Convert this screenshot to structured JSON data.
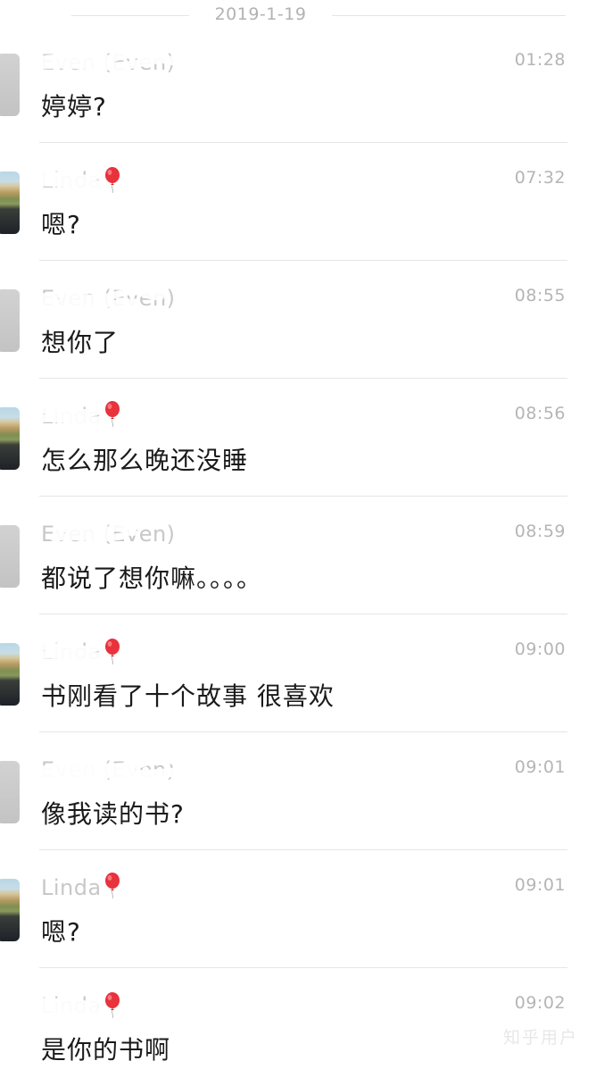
{
  "date_divider": "2019-1-19",
  "messages": [
    {
      "sender": "Even (Even)",
      "avatar": "even-avatar",
      "time": "01:28",
      "text": "婷婷?"
    },
    {
      "sender": "Linda",
      "avatar": "linda-avatar",
      "time": "07:32",
      "text": "嗯?"
    },
    {
      "sender": "Even (Even)",
      "avatar": "even-avatar",
      "time": "08:55",
      "text": "想你了"
    },
    {
      "sender": "Linda",
      "avatar": "linda-avatar",
      "time": "08:56",
      "text": "怎么那么晚还没睡"
    },
    {
      "sender": "Even (Even)",
      "avatar": "even-avatar",
      "time": "08:59",
      "text": "都说了想你嘛。。。。"
    },
    {
      "sender": "Linda",
      "avatar": "linda-avatar",
      "time": "09:00",
      "text": "书刚看了十个故事 很喜欢"
    },
    {
      "sender": "Even (Even)",
      "avatar": "even-avatar",
      "time": "09:01",
      "text": "像我读的书?"
    },
    {
      "sender": "Linda",
      "avatar": "linda-avatar",
      "time": "09:01",
      "text": "嗯?"
    },
    {
      "sender": "Linda",
      "avatar": "linda-avatar",
      "time": "09:02",
      "text": "是你的书啊"
    }
  ],
  "watermark": "知乎用户",
  "colors": {
    "time": "#b5b5b5",
    "message_text": "#1a1a1a",
    "balloon": "#e8323c",
    "separator": "#e6e6e6"
  }
}
